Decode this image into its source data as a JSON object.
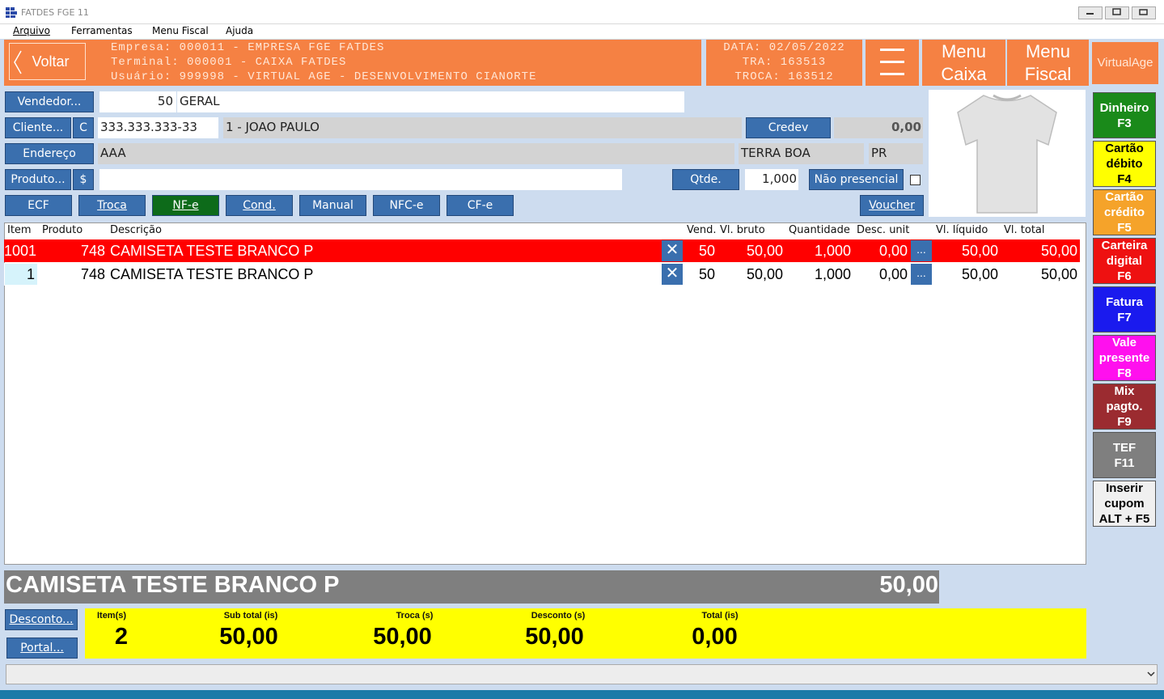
{
  "window": {
    "title": "FATDES FGE 11",
    "min": "▭",
    "max": "▣",
    "close": "▭"
  },
  "menubar": [
    "Arquivo",
    "Ferramentas",
    "Menu Fiscal",
    "Ajuda"
  ],
  "header": {
    "back_label": "Voltar",
    "empresa": "Empresa: 000011 - EMPRESA FGE FATDES",
    "terminal": "Terminal: 000001 - CAIXA FATDES",
    "usuario": "Usuário: 999998 - VIRTUAL AGE - DESENVOLVIMENTO CIANORTE",
    "data": "DATA: 02/05/2022",
    "tra": "TRA: 163513",
    "troca": "TROCA: 163512",
    "menu_caixa": [
      "Menu",
      "Caixa"
    ],
    "menu_fiscal": [
      "Menu",
      "Fiscal"
    ],
    "virtualage": "VirtualAge",
    "accent": "#f58143"
  },
  "form": {
    "vendedor_btn": "Vendedor...",
    "vendedor_code": "50",
    "vendedor_name": "GERAL",
    "cliente_btn": "Cliente...",
    "cliente_c": "C",
    "cliente_doc": "333.333.333-33",
    "cliente_name": "1 - JOAO PAULO",
    "credev_btn": "Credev",
    "credev_value": "0,00",
    "endereco_btn": "Endereço",
    "endereco": "AAA",
    "cidade": "TERRA BOA",
    "uf": "PR",
    "produto_btn": "Produto...",
    "produto_dollar": "$",
    "produto_value": "",
    "qtde_btn": "Qtde.",
    "qtde_value": "1,000",
    "nao_presencial": "Não presencial"
  },
  "doc_buttons": [
    "ECF",
    "Troca",
    "NF-e",
    "Cond.",
    "Manual",
    "NFC-e",
    "CF-e"
  ],
  "voucher": "Voucher",
  "grid": {
    "headers": [
      "Item",
      "Produto",
      "Descrição",
      "Vend.",
      "Vl. bruto",
      "Quantidade",
      "Desc. unit",
      "Vl. líquido",
      "Vl. total"
    ],
    "rows": [
      {
        "item": "1001",
        "produto": "748",
        "descricao": "CAMISETA TESTE BRANCO P",
        "vend": "50",
        "bruto": "50,00",
        "qtd": "1,000",
        "desc": "0,00",
        "liquido": "50,00",
        "total": "50,00",
        "selected": true
      },
      {
        "item": "1",
        "produto": "748",
        "descricao": "CAMISETA TESTE BRANCO P",
        "vend": "50",
        "bruto": "50,00",
        "qtd": "1,000",
        "desc": "0,00",
        "liquido": "50,00",
        "total": "50,00",
        "selected": false
      }
    ],
    "x_glyph": "✕",
    "dots_glyph": "..."
  },
  "current": {
    "description": "CAMISETA TESTE BRANCO P",
    "value": "50,00"
  },
  "bottom": {
    "desconto_btn": "Desconto...",
    "portal_btn": "Portal..."
  },
  "totals": [
    {
      "label": "Item(s)",
      "value": "2"
    },
    {
      "label": "Sub total (is)",
      "value": "50,00"
    },
    {
      "label": "Troca (s)",
      "value": "50,00"
    },
    {
      "label": "Desconto (s)",
      "value": "50,00"
    },
    {
      "label": "Total (is)",
      "value": "0,00"
    }
  ],
  "payments": [
    {
      "lines": [
        "Dinheiro",
        "F3"
      ],
      "bg": "#1a8a1a",
      "fg": "#ffffff"
    },
    {
      "lines": [
        "Cartão",
        "débito",
        "F4"
      ],
      "bg": "#ffff00",
      "fg": "#000000"
    },
    {
      "lines": [
        "Cartão",
        "crédito",
        "F5"
      ],
      "bg": "#f5a32a",
      "fg": "#ffffff"
    },
    {
      "lines": [
        "Carteira",
        "digital",
        "F6"
      ],
      "bg": "#ee1111",
      "fg": "#ffffff"
    },
    {
      "lines": [
        "Fatura",
        "F7"
      ],
      "bg": "#1a1aee",
      "fg": "#ffffff"
    },
    {
      "lines": [
        "Vale",
        "presente",
        "F8"
      ],
      "bg": "#ff10ee",
      "fg": "#ffffff"
    },
    {
      "lines": [
        "Mix",
        "pagto.",
        "F9"
      ],
      "bg": "#9b2b30",
      "fg": "#ffffff"
    },
    {
      "lines": [
        "TEF",
        "F11"
      ],
      "bg": "#7f7f7f",
      "fg": "#ffffff"
    },
    {
      "lines": [
        "Inserir",
        "cupom",
        "ALT + F5"
      ],
      "bg": "#f0f0f0",
      "fg": "#000000"
    }
  ],
  "icons": {
    "app": "app-logo-icon",
    "hamburger": "hamburger-icon",
    "product": "tshirt-image",
    "dropdown": "chevron-down-icon"
  }
}
